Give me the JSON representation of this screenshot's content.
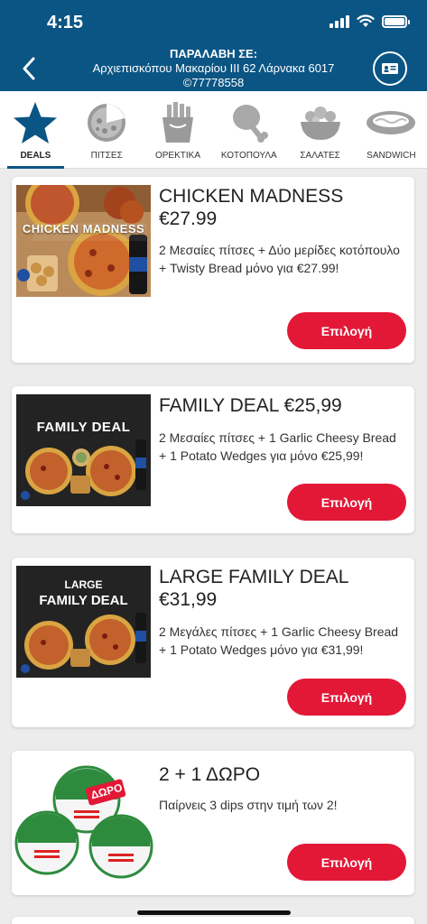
{
  "status_bar": {
    "time": "4:15"
  },
  "header": {
    "pickup_title": "ΠΑΡΑΛΑΒΗ ΣΕ:",
    "address": "Αρχιεπισκόπου Μακαρίου ΙΙΙ 62 Λάρνακα 6017",
    "phone": "©77778558"
  },
  "tabs": [
    {
      "label": "DEALS",
      "icon": "star-icon",
      "active": true
    },
    {
      "label": "ΠΙΤΣΕΣ",
      "icon": "pizza-icon"
    },
    {
      "label": "ΟΡΕΚΤΙΚΑ",
      "icon": "fries-icon"
    },
    {
      "label": "ΚΟΤΟΠΟΥΛΑ",
      "icon": "chicken-leg-icon"
    },
    {
      "label": "ΣΑΛΑΤΕΣ",
      "icon": "salad-bowl-icon"
    },
    {
      "label": "SANDWICH",
      "icon": "sandwich-icon"
    }
  ],
  "deals": [
    {
      "title_line1": "CHICKEN MADNESS",
      "title_line2": "€27.99",
      "description": "2 Μεσαίες πίτσες + Δύο μερίδες κοτόπουλο + Twisty Bread μόνο για €27.99!",
      "image_text": "CHICKEN MADNESS",
      "button": "Επιλογή"
    },
    {
      "title_line1": "FAMILY DEAL €25,99",
      "description": "2 Μεσαίες πίτσες + 1 Garlic Cheesy Bread + 1 Potato Wedges για μόνο €25,99!",
      "image_text": "FAMILY DEAL",
      "button": "Επιλογή"
    },
    {
      "title_line1": "LARGE FAMILY DEAL",
      "title_line2": "€31,99",
      "description": "2 Μεγάλες πίτσες + 1 Garlic Cheesy Bread + 1 Potato Wedges μόνο για €31,99!",
      "image_text_1": "LARGE",
      "image_text_2": "FAMILY DEAL",
      "button": "Επιλογή"
    },
    {
      "title_line1": "2 + 1 ΔΩΡΟ",
      "description": "Παίρνεις 3 dips στην τιμή των 2!",
      "image_badge": "ΔΩΡΟ",
      "button": "Επιλογή"
    }
  ],
  "colors": {
    "brand_blue": "#0b5584",
    "button_red": "#e31837"
  }
}
